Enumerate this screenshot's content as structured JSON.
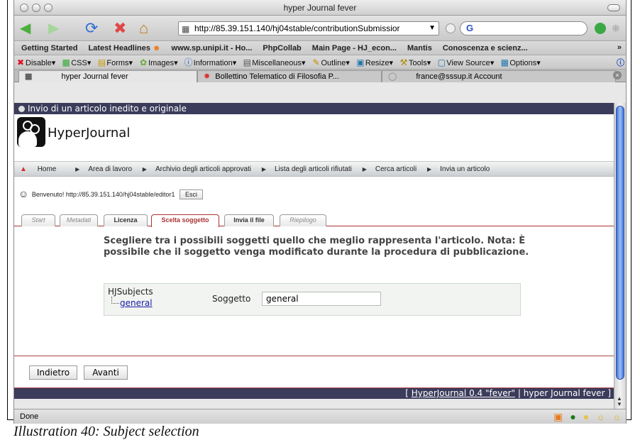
{
  "window": {
    "title": "hyper Journal fever"
  },
  "nav": {
    "url": "http://85.39.151.140/hj04stable/contributionSubmissior",
    "search_placeholder": "G"
  },
  "bookmarks": [
    "Getting Started",
    "Latest Headlines",
    "www.sp.unipi.it - Ho...",
    "PhpCollab",
    "Main Page - HJ_econ...",
    "Mantis",
    "Conoscenza e scienz..."
  ],
  "bookmarks_more": "»",
  "devbar": [
    "Disable",
    "CSS",
    "Forms",
    "Images",
    "Information",
    "Miscellaneous",
    "Outline",
    "Resize",
    "Tools",
    "View Source",
    "Options"
  ],
  "tabs": [
    "hyper Journal fever",
    "Bollettino Telematico di Filosofia P...",
    "france@sssup.it Account"
  ],
  "page": {
    "header": "Invio di un articolo inedito e originale",
    "brand": "HyperJournal",
    "menu": [
      "Home",
      "Area di lavoro",
      "Archivio degli articoli approvati",
      "Lista degli articoli rifiutati",
      "Cerca articoli",
      "Invia un articolo"
    ],
    "welcome": "Benvenuto! http://85.39.151.140/hj04stable/editor1",
    "logout": "Esci",
    "wizard_tabs": [
      "Start",
      "Metadati",
      "Licenza",
      "Scelta soggetto",
      "Invia il file",
      "Riepilogo"
    ],
    "intro": "Scegliere tra i possibili soggetti quello che meglio rappresenta l'articolo. Nota: È possibile che il soggetto venga modificato durante la procedura di pubblicazione.",
    "subject_tree_title": "HJSubjects",
    "subject_tree_item": "general",
    "subject_label": "Soggetto",
    "subject_value": "general",
    "back": "Indietro",
    "next": "Avanti",
    "footer_open": "[ ",
    "footer_link": "HyperJournal 0.4 \"fever\"",
    "footer_rest": " | hyper Journal fever ]"
  },
  "status": "Done",
  "caption": "Illustration 40: Subject selection"
}
